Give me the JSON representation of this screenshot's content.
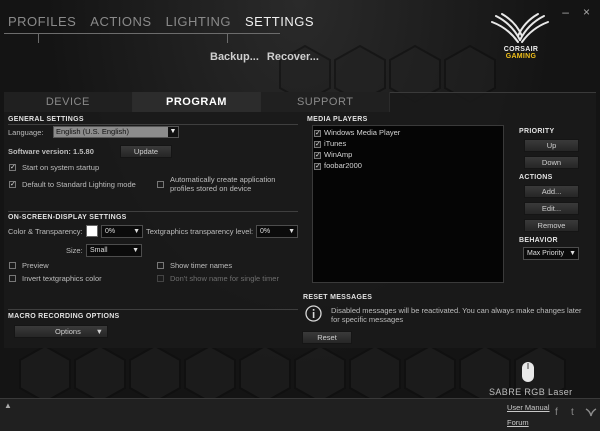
{
  "topnav": {
    "tabs": [
      "PROFILES",
      "ACTIONS",
      "LIGHTING",
      "SETTINGS"
    ],
    "active": "SETTINGS",
    "sub_actions": [
      "Backup...",
      "Recover..."
    ]
  },
  "window": {
    "minimize": "–",
    "close": "×"
  },
  "logo": {
    "line1": "CORSAIR",
    "line2": "GAMING"
  },
  "subtabs": [
    "DEVICE",
    "PROGRAM",
    "SUPPORT"
  ],
  "general": {
    "title": "GENERAL SETTINGS",
    "language_label": "Language:",
    "language_value": "English (U.S. English)",
    "version_label": "Software version: 1.5.80",
    "update_button": "Update",
    "start_on_startup": "Start on system startup",
    "default_lighting": "Default to Standard Lighting mode",
    "auto_create": "Automatically create application profiles stored on device"
  },
  "osd": {
    "title": "ON-SCREEN-DISPLAY SETTINGS",
    "color_label": "Color & Transparency:",
    "color_transparency": "0%",
    "textgraphics_label": "Textgraphics transparency level:",
    "textgraphics_value": "0%",
    "size_label": "Size:",
    "size_value": "Small",
    "preview": "Preview",
    "invert": "Invert textgraphics color",
    "show_timer": "Show timer names",
    "dont_show_single": "Don't show name for single timer",
    "swatch_color": "#ffffff"
  },
  "macro": {
    "title": "MACRO RECORDING OPTIONS",
    "options_button": "Options"
  },
  "media": {
    "title": "MEDIA PLAYERS",
    "players": [
      "Windows Media Player",
      "iTunes",
      "WinAmp",
      "foobar2000"
    ]
  },
  "priority": {
    "title": "PRIORITY",
    "up": "Up",
    "down": "Down"
  },
  "actions": {
    "title": "ACTIONS",
    "add": "Add...",
    "edit": "Edit...",
    "remove": "Remove"
  },
  "behavior": {
    "title": "BEHAVIOR",
    "value": "Max Priority"
  },
  "reset": {
    "title": "RESET MESSAGES",
    "text": "Disabled messages will be reactivated. You can always make changes later for specific messages",
    "button": "Reset"
  },
  "device": {
    "name": "SABRE RGB Laser"
  },
  "footer": {
    "user_manual": "User Manual",
    "forum": "Forum",
    "collapse": "▲"
  },
  "social": {
    "facebook": "f",
    "twitter": "t"
  }
}
